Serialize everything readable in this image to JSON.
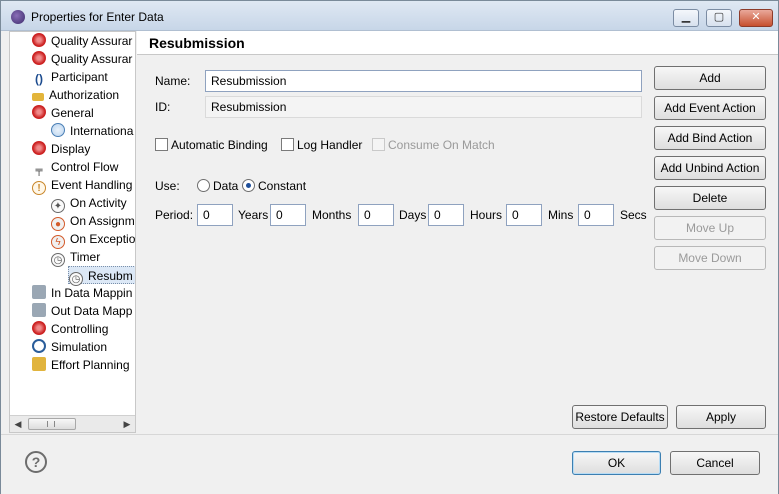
{
  "window": {
    "title": "Properties for Enter Data"
  },
  "tree": {
    "items": [
      {
        "label": "Quality Assurar",
        "icon": "gear-icon"
      },
      {
        "label": "Quality Assurar",
        "icon": "gear-icon"
      },
      {
        "label": "Participant",
        "icon": "participant-icon"
      },
      {
        "label": "Authorization",
        "icon": "key-icon"
      },
      {
        "label": "General",
        "icon": "gear-icon"
      },
      {
        "label": "Internationa",
        "icon": "globe-icon"
      },
      {
        "label": "Display",
        "icon": "gear-icon"
      },
      {
        "label": "Control Flow",
        "icon": "flow-icon"
      },
      {
        "label": "Event Handling",
        "icon": "event-icon"
      },
      {
        "label": "On Activity",
        "icon": "activity-event-icon"
      },
      {
        "label": "On Assignm",
        "icon": "assignment-event-icon"
      },
      {
        "label": "On Exceptio",
        "icon": "exception-event-icon"
      },
      {
        "label": "Timer",
        "icon": "timer-icon"
      },
      {
        "label": "Resubm",
        "icon": "timer-icon"
      },
      {
        "label": "In Data Mappin",
        "icon": "in-data-mapping-icon"
      },
      {
        "label": "Out Data Mapp",
        "icon": "out-data-mapping-icon"
      },
      {
        "label": "Controlling",
        "icon": "gear-icon"
      },
      {
        "label": "Simulation",
        "icon": "simulation-icon"
      },
      {
        "label": "Effort Planning",
        "icon": "effort-icon"
      }
    ]
  },
  "page": {
    "title": "Resubmission",
    "name_label": "Name:",
    "name_value": "Resubmission",
    "id_label": "ID:",
    "id_value": "Resubmission",
    "checkboxes": {
      "automatic_binding": "Automatic Binding",
      "log_handler": "Log Handler",
      "consume_on_match": "Consume On Match"
    },
    "use": {
      "label": "Use:",
      "data": "Data",
      "constant": "Constant",
      "selected": "Constant"
    },
    "period": {
      "label": "Period:",
      "years_value": "0",
      "years_label": "Years",
      "months_value": "0",
      "months_label": "Months",
      "days_value": "0",
      "days_label": "Days",
      "hours_value": "0",
      "hours_label": "Hours",
      "mins_value": "0",
      "mins_label": "Mins",
      "secs_value": "0",
      "secs_label": "Secs"
    },
    "buttons": {
      "add": "Add",
      "add_event_action": "Add Event Action",
      "add_bind_action": "Add Bind Action",
      "add_unbind_action": "Add Unbind Action",
      "delete": "Delete",
      "move_up": "Move Up",
      "move_down": "Move Down",
      "restore_defaults": "Restore Defaults",
      "apply": "Apply"
    }
  },
  "footer": {
    "ok": "OK",
    "cancel": "Cancel"
  },
  "colors": {
    "title_bar": "#c7d6e8",
    "selected_row": "#dce8f6",
    "accent": "#1f4f9a"
  }
}
